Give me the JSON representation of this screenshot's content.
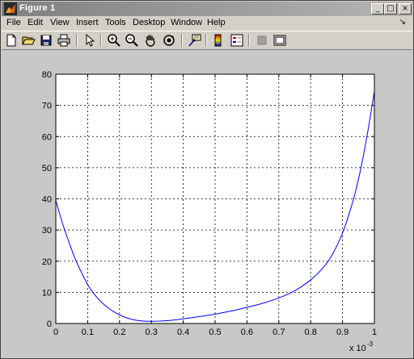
{
  "window": {
    "title": "Figure 1",
    "controls": {
      "minimize": "_",
      "maximize": "□",
      "close": "×"
    }
  },
  "menu": {
    "items": [
      "File",
      "Edit",
      "View",
      "Insert",
      "Tools",
      "Desktop",
      "Window",
      "Help"
    ],
    "arrow": "↘"
  },
  "toolbar": {
    "buttons": [
      {
        "name": "new-figure-icon"
      },
      {
        "name": "open-file-icon"
      },
      {
        "name": "save-figure-icon"
      },
      {
        "name": "print-figure-icon"
      },
      {
        "name": "edit-plot-arrow-icon"
      },
      {
        "name": "zoom-in-icon"
      },
      {
        "name": "zoom-out-icon"
      },
      {
        "name": "pan-hand-icon"
      },
      {
        "name": "rotate-3d-icon"
      },
      {
        "name": "data-cursor-icon"
      },
      {
        "name": "insert-colorbar-icon"
      },
      {
        "name": "insert-legend-icon"
      },
      {
        "name": "hide-plot-tools-icon"
      },
      {
        "name": "show-plot-tools-icon"
      }
    ]
  },
  "colors": {
    "line": "#0000ff",
    "axes_bg": "#ffffff",
    "figure_bg": "#c8c8c8"
  },
  "chart_data": {
    "type": "line",
    "title": "",
    "xlabel": "",
    "ylabel": "",
    "x_multiplier_label": "x 10",
    "x_multiplier_exponent": "-3",
    "xlim": [
      0,
      1
    ],
    "ylim": [
      0,
      80
    ],
    "xticks": [
      "0",
      "0.1",
      "0.2",
      "0.3",
      "0.4",
      "0.5",
      "0.6",
      "0.7",
      "0.8",
      "0.9",
      "1"
    ],
    "yticks": [
      "0",
      "10",
      "20",
      "30",
      "40",
      "50",
      "60",
      "70",
      "80"
    ],
    "grid": true,
    "grid_style": "dashed",
    "series": [
      {
        "x": [
          0,
          0.02,
          0.04,
          0.06,
          0.08,
          0.1,
          0.12,
          0.15,
          0.18,
          0.21,
          0.24,
          0.27,
          0.3,
          0.33,
          0.36,
          0.4,
          0.45,
          0.5,
          0.55,
          0.6,
          0.65,
          0.7,
          0.75,
          0.8,
          0.84,
          0.87,
          0.9,
          0.92,
          0.94,
          0.96,
          0.98,
          1.0
        ],
        "y": [
          39.5,
          32.5,
          26.5,
          21.0,
          16.5,
          12.5,
          9.5,
          6.2,
          3.9,
          2.3,
          1.3,
          0.8,
          0.7,
          0.8,
          1.0,
          1.5,
          2.2,
          3.0,
          4.0,
          5.2,
          6.5,
          8.2,
          10.5,
          14.0,
          18.0,
          22.5,
          29.0,
          35.0,
          42.0,
          51.0,
          62.0,
          74.5
        ]
      }
    ]
  }
}
